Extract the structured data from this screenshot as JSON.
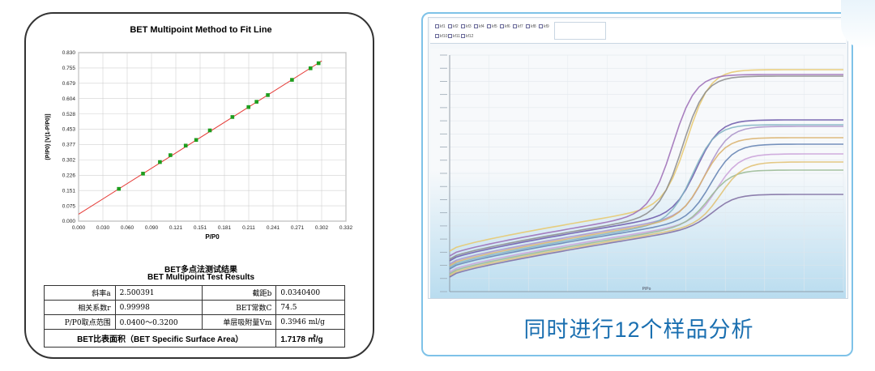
{
  "bet_chart": {
    "title": "BET Multipoint Method to Fit Line",
    "xlabel": "P/P0",
    "ylabel": "(P/P0) [V(1-P/P0)]",
    "x_ticks": [
      "0.000",
      "0.030",
      "0.060",
      "0.090",
      "0.121",
      "0.151",
      "0.181",
      "0.211",
      "0.241",
      "0.271",
      "0.302",
      "0.332"
    ],
    "y_ticks": [
      "0.000",
      "0.075",
      "0.151",
      "0.226",
      "0.302",
      "0.377",
      "0.453",
      "0.528",
      "0.604",
      "0.679",
      "0.755",
      "0.830"
    ]
  },
  "chart_data": {
    "type": "scatter",
    "title": "BET Multipoint Method to Fit Line",
    "xlabel": "P/P0",
    "ylabel": "(P/P0) [V(1-P/P0)]",
    "xlim": [
      0,
      0.332
    ],
    "ylim": [
      0,
      0.83
    ],
    "grid": true,
    "points": [
      {
        "x": 0.05,
        "y": 0.159
      },
      {
        "x": 0.08,
        "y": 0.234
      },
      {
        "x": 0.101,
        "y": 0.291
      },
      {
        "x": 0.114,
        "y": 0.325
      },
      {
        "x": 0.133,
        "y": 0.372
      },
      {
        "x": 0.146,
        "y": 0.4
      },
      {
        "x": 0.163,
        "y": 0.447
      },
      {
        "x": 0.191,
        "y": 0.513
      },
      {
        "x": 0.211,
        "y": 0.562
      },
      {
        "x": 0.221,
        "y": 0.588
      },
      {
        "x": 0.235,
        "y": 0.621
      },
      {
        "x": 0.265,
        "y": 0.696
      },
      {
        "x": 0.288,
        "y": 0.753
      },
      {
        "x": 0.298,
        "y": 0.778
      }
    ],
    "fit_line": {
      "slope": 2.500391,
      "intercept": 0.03404
    },
    "point_color": "#1e9e1e",
    "line_color": "#e53935"
  },
  "results": {
    "title_cn": "BET多点法测试结果",
    "title_en": "BET Multipoint Test Results",
    "rows": [
      {
        "l1": "斜率a",
        "v1": "2.500391",
        "l2": "截距b",
        "v2": "0.0340400"
      },
      {
        "l1": "相关系数r",
        "v1": "0.99998",
        "l2": "BET常数C",
        "v2": "74.5"
      },
      {
        "l1": "P/P0取点范围",
        "v1": "0.0400～0.3200",
        "l2": "单层吸附量Vm",
        "v2": "0.3946 ml/g"
      }
    ],
    "surface_label": "BET比表面积（BET Specific Surface Area）",
    "surface_value": "1.7178 ㎡/g"
  },
  "right_panel": {
    "caption": "同时进行12个样品分析",
    "accent_color": "#1a6fb0",
    "border_color": "#7ec2e8",
    "legend": {
      "row1": [
        "kf1",
        "kf2",
        "kf3",
        "kf4",
        "kf5",
        "kf6",
        "kf7",
        "kf8",
        "kf9"
      ],
      "row2": [
        "kf10",
        "kf11",
        "kf12"
      ]
    },
    "x_axis_label": "P/Po"
  }
}
